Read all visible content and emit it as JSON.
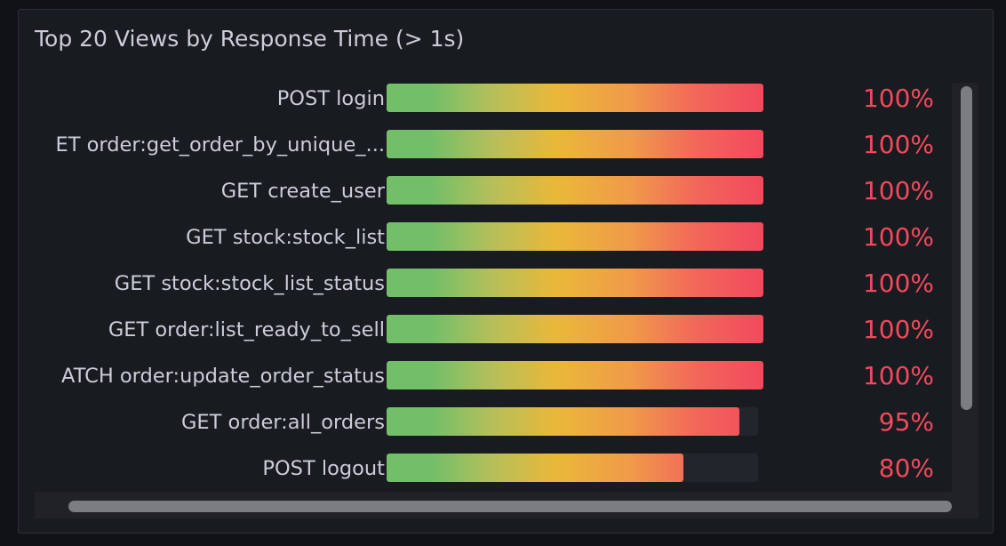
{
  "panel": {
    "title": "Top 20 Views by Response Time (> 1s)"
  },
  "chart_data": {
    "type": "bar",
    "orientation": "horizontal",
    "unit": "%",
    "xlim": [
      0,
      100
    ],
    "categories": [
      "POST login",
      "ET order:get_order_by_unique_...",
      "GET create_user",
      "GET stock:stock_list",
      "GET stock:stock_list_status",
      "GET order:list_ready_to_sell",
      "ATCH order:update_order_status",
      "GET order:all_orders",
      "POST logout"
    ],
    "values": [
      100,
      100,
      100,
      100,
      100,
      100,
      100,
      95,
      80
    ],
    "value_labels": [
      "100%",
      "100%",
      "100%",
      "100%",
      "100%",
      "100%",
      "100%",
      "95%",
      "80%"
    ],
    "colors": {
      "gradient": [
        "#73bf69",
        "#eab839",
        "#f2495c"
      ],
      "value_text": "#f2495c",
      "track": "#22252b"
    }
  }
}
